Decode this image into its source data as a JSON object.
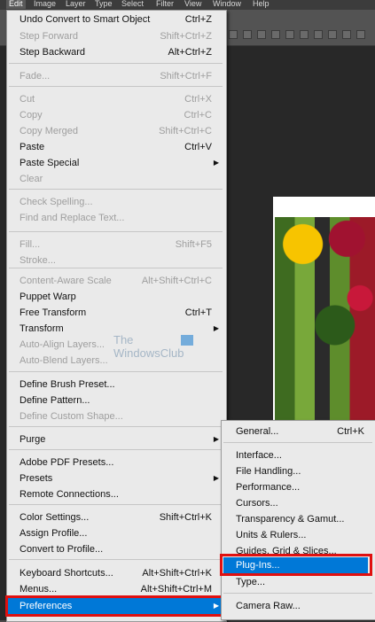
{
  "menubar": [
    "Edit",
    "Image",
    "Layer",
    "Type",
    "Select",
    "Filter",
    "View",
    "Window",
    "Help"
  ],
  "watermark": {
    "line1": "The",
    "line2": "WindowsClub"
  },
  "edit_menu": [
    {
      "label": "Undo Convert to Smart Object",
      "shortcut": "Ctrl+Z",
      "enabled": true
    },
    {
      "label": "Step Forward",
      "shortcut": "Shift+Ctrl+Z",
      "enabled": false
    },
    {
      "label": "Step Backward",
      "shortcut": "Alt+Ctrl+Z",
      "enabled": true
    },
    {
      "label": "Fade...",
      "shortcut": "Shift+Ctrl+F",
      "enabled": false
    },
    {
      "label": "Cut",
      "shortcut": "Ctrl+X",
      "enabled": false
    },
    {
      "label": "Copy",
      "shortcut": "Ctrl+C",
      "enabled": false
    },
    {
      "label": "Copy Merged",
      "shortcut": "Shift+Ctrl+C",
      "enabled": false
    },
    {
      "label": "Paste",
      "shortcut": "Ctrl+V",
      "enabled": true
    },
    {
      "label": "Paste Special",
      "shortcut": "",
      "enabled": true,
      "submenu": true
    },
    {
      "label": "Clear",
      "shortcut": "",
      "enabled": false
    },
    {
      "label": "Check Spelling...",
      "shortcut": "",
      "enabled": false
    },
    {
      "label": "Find and Replace Text...",
      "shortcut": "",
      "enabled": false
    },
    {
      "label": "Fill...",
      "shortcut": "Shift+F5",
      "enabled": false
    },
    {
      "label": "Stroke...",
      "shortcut": "",
      "enabled": false
    },
    {
      "label": "Content-Aware Scale",
      "shortcut": "Alt+Shift+Ctrl+C",
      "enabled": false
    },
    {
      "label": "Puppet Warp",
      "shortcut": "",
      "enabled": true
    },
    {
      "label": "Free Transform",
      "shortcut": "Ctrl+T",
      "enabled": true
    },
    {
      "label": "Transform",
      "shortcut": "",
      "enabled": true,
      "submenu": true
    },
    {
      "label": "Auto-Align Layers...",
      "shortcut": "",
      "enabled": false
    },
    {
      "label": "Auto-Blend Layers...",
      "shortcut": "",
      "enabled": false
    },
    {
      "label": "Define Brush Preset...",
      "shortcut": "",
      "enabled": true
    },
    {
      "label": "Define Pattern...",
      "shortcut": "",
      "enabled": true
    },
    {
      "label": "Define Custom Shape...",
      "shortcut": "",
      "enabled": false
    },
    {
      "label": "Purge",
      "shortcut": "",
      "enabled": true,
      "submenu": true
    },
    {
      "label": "Adobe PDF Presets...",
      "shortcut": "",
      "enabled": true
    },
    {
      "label": "Presets",
      "shortcut": "",
      "enabled": true,
      "submenu": true
    },
    {
      "label": "Remote Connections...",
      "shortcut": "",
      "enabled": true
    },
    {
      "label": "Color Settings...",
      "shortcut": "Shift+Ctrl+K",
      "enabled": true
    },
    {
      "label": "Assign Profile...",
      "shortcut": "",
      "enabled": true
    },
    {
      "label": "Convert to Profile...",
      "shortcut": "",
      "enabled": true
    },
    {
      "label": "Keyboard Shortcuts...",
      "shortcut": "Alt+Shift+Ctrl+K",
      "enabled": true
    },
    {
      "label": "Menus...",
      "shortcut": "Alt+Shift+Ctrl+M",
      "enabled": true
    },
    {
      "label": "Preferences",
      "shortcut": "",
      "enabled": true,
      "submenu": true,
      "highlighted": true
    }
  ],
  "preferences_menu": [
    {
      "label": "General...",
      "shortcut": "Ctrl+K"
    },
    {
      "label": "Interface...",
      "shortcut": ""
    },
    {
      "label": "File Handling...",
      "shortcut": ""
    },
    {
      "label": "Performance...",
      "shortcut": ""
    },
    {
      "label": "Cursors...",
      "shortcut": ""
    },
    {
      "label": "Transparency & Gamut...",
      "shortcut": ""
    },
    {
      "label": "Units & Rulers...",
      "shortcut": ""
    },
    {
      "label": "Guides, Grid & Slices...",
      "shortcut": ""
    },
    {
      "label": "Plug-Ins...",
      "shortcut": "",
      "highlighted": true
    },
    {
      "label": "Type...",
      "shortcut": ""
    },
    {
      "label": "Camera Raw...",
      "shortcut": ""
    }
  ],
  "colors": {
    "highlight": "#0078d7",
    "annotation": "#e01010",
    "menu_bg": "#eaeaea"
  }
}
